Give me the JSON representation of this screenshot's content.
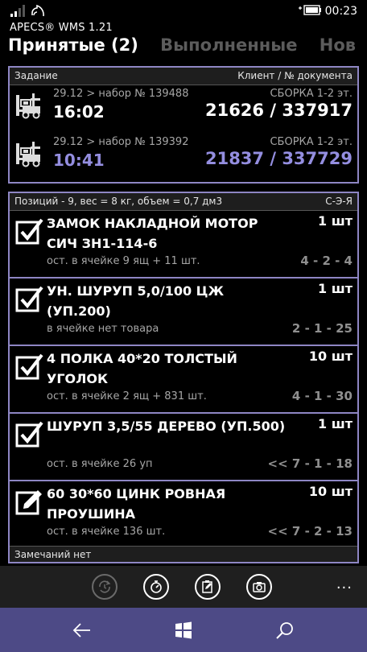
{
  "status_bar": {
    "time": "00:23"
  },
  "app": {
    "title": "APECS® WMS 1.21"
  },
  "pivot": {
    "tabs": [
      "Принятые (2)",
      "Выполненные",
      "Нов"
    ]
  },
  "tasks": {
    "header_left": "Задание",
    "header_right": "Клиент / № документа",
    "rows": [
      {
        "sub": "29.12 > набор № 139488",
        "zone": "СБОРКА 1-2 эт.",
        "time": "16:02",
        "doc": "21626 / 337917"
      },
      {
        "sub": "29.12 > набор № 139392",
        "zone": "СБОРКА 1-2 эт.",
        "time": "10:41",
        "doc": "21837 / 337729"
      }
    ]
  },
  "items": {
    "header_left": "Позиций - 9, вес = 8 кг, объем = 0,7 дм3",
    "header_right": "С-Э-Я",
    "rows": [
      {
        "name": "ЗАМОК НАКЛАДНОЙ МОТОР СИЧ ЗН1-114-6",
        "qty": "1 шт",
        "note": "ост. в ячейке 9 ящ + 11 шт.",
        "loc": "4 - 2 - 4",
        "icon": "checkbox-checked-icon"
      },
      {
        "name": "УН. ШУРУП 5,0/100 ЦЖ (УП.200)",
        "qty": "1 шт",
        "note": "в ячейке нет товара",
        "loc": "2 - 1 - 25",
        "icon": "checkbox-checked-icon"
      },
      {
        "name": "4 ПОЛКА 40*20 ТОЛСТЫЙ УГОЛОК",
        "qty": "10 шт",
        "note": "ост. в ячейке 2 ящ + 831 шт.",
        "loc": "4 - 1 - 30",
        "icon": "checkbox-checked-icon"
      },
      {
        "name": "ШУРУП 3,5/55 ДЕРЕВО (УП.500)",
        "qty": "1 шт",
        "note": "ост. в ячейке 26 уп",
        "loc": "<< 7 - 1 - 18",
        "icon": "checkbox-checked-icon"
      },
      {
        "name": "60 30*60 ЦИНК РОВНАЯ ПРОУШИНА",
        "qty": "10 шт",
        "note": "ост. в ячейке 136 шт.",
        "loc": "<< 7 - 2 - 13",
        "icon": "edit-checkbox-icon"
      }
    ],
    "footer": "Замечаний нет"
  },
  "app_bar": {
    "more": "..."
  }
}
